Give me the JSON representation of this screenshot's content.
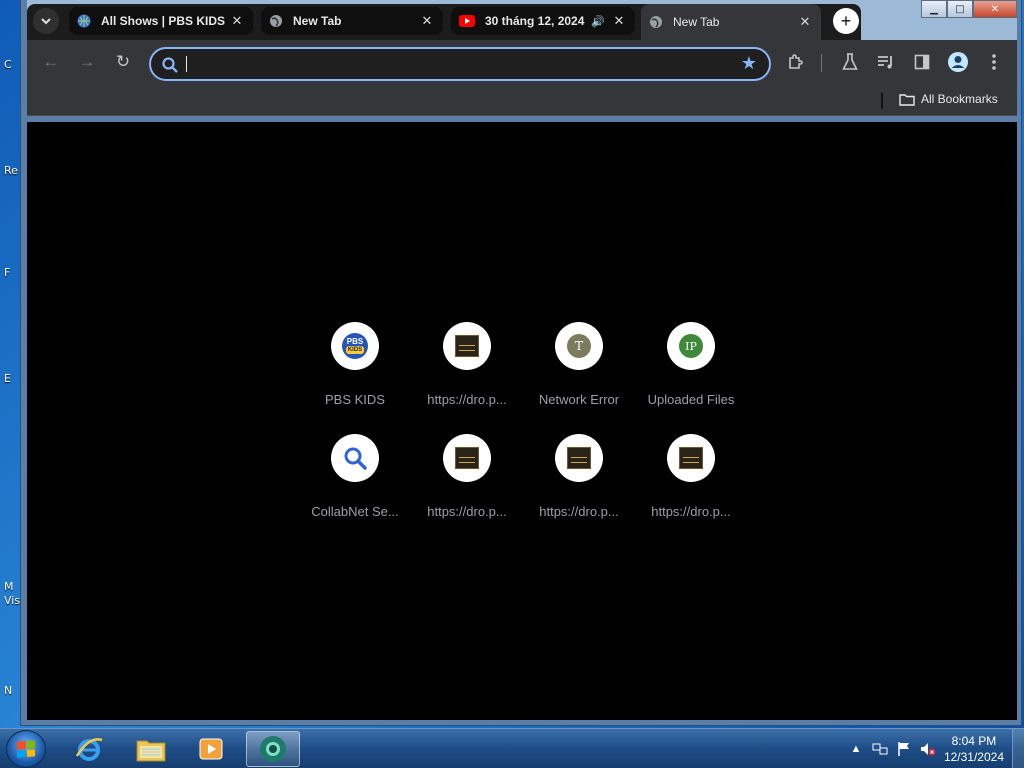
{
  "desktop": {
    "icon_fragments": [
      "C",
      "Re",
      "F",
      "E",
      "M",
      "Vis",
      "N"
    ]
  },
  "window": {
    "controls": {
      "minimize": "▁",
      "maximize": "□",
      "close": "✕"
    }
  },
  "tabs": [
    {
      "title": "All Shows | PBS KIDS",
      "icon": "pbs-globe-icon",
      "close": "✕"
    },
    {
      "title": "New Tab",
      "icon": "globe-icon",
      "close": "✕"
    },
    {
      "title": "30 tháng 12, 2024",
      "icon": "youtube-icon",
      "audio": "🔊",
      "close": "✕"
    },
    {
      "title": "New Tab",
      "icon": "globe-icon",
      "close": "✕",
      "active": true
    }
  ],
  "new_tab": "+",
  "toolbar": {
    "back": "←",
    "forward": "→",
    "reload": "↻",
    "omnibox_value": "",
    "omnibox_placeholder": ""
  },
  "bookmarks": {
    "all_bookmarks": "All Bookmarks"
  },
  "shortcuts": [
    {
      "label": "PBS KIDS",
      "icon": "pbs-kids-logo"
    },
    {
      "label": "https://dro.p...",
      "icon": "site-thumbnail"
    },
    {
      "label": "Network Error",
      "icon": "letter-t",
      "letter": "T",
      "color": "#7b7b5e"
    },
    {
      "label": "Uploaded Files",
      "icon": "letter-ip",
      "letter": "IP",
      "color": "#3f8a3a"
    },
    {
      "label": "CollabNet Se...",
      "icon": "search-icon"
    },
    {
      "label": "https://dro.p...",
      "icon": "site-thumbnail"
    },
    {
      "label": "https://dro.p...",
      "icon": "site-thumbnail"
    },
    {
      "label": "https://dro.p...",
      "icon": "site-thumbnail"
    }
  ],
  "pbs_logo": {
    "top": "PBS",
    "bottom": "KIDS"
  },
  "taskbar": {
    "apps": [
      "internet-explorer",
      "file-explorer",
      "media-player",
      "chrome"
    ],
    "clock": {
      "time": "8:04 PM",
      "date": "12/31/2024"
    },
    "tray_expand": "▲"
  }
}
